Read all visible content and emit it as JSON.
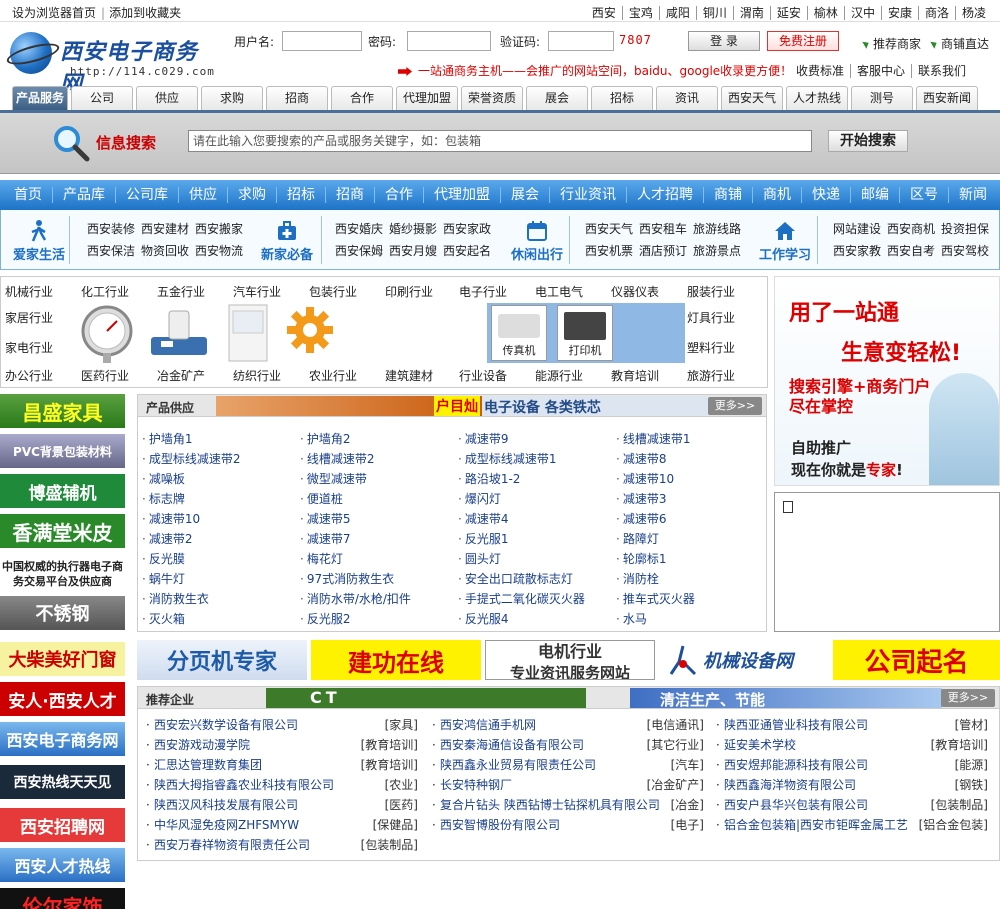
{
  "topbar": {
    "set_home": "设为浏览器首页",
    "bookmark": "添加到收藏夹",
    "cities": [
      "西安",
      "宝鸡",
      "咸阳",
      "铜川",
      "渭南",
      "延安",
      "榆林",
      "汉中",
      "安康",
      "商洛",
      "杨凌"
    ]
  },
  "logo": {
    "name": "西安电子商务网",
    "url": "http://114.c029.com"
  },
  "login": {
    "username_label": "用户名:",
    "password_label": "密码:",
    "captcha_label": "验证码:",
    "captcha_value": "7807",
    "login_button": "登 录",
    "register_button": "免费注册",
    "recommend_merchant": "推荐商家",
    "shop_direct": "商铺直达"
  },
  "promo": {
    "text": "一站通商务主机——会推广的网站空间，baidu、google收录更方便！",
    "links": [
      "收费标准",
      "客服中心",
      "联系我们"
    ]
  },
  "tabs": [
    "产品服务",
    "公司",
    "供应",
    "求购",
    "招商",
    "合作",
    "代理加盟",
    "荣誉资质",
    "展会",
    "招标",
    "资讯",
    "西安天气",
    "人才热线",
    "测号",
    "西安新闻"
  ],
  "search": {
    "label": "信息搜索",
    "placeholder": "请在此输入您要搜索的产品或服务关键字，如：包装箱",
    "button": "开始搜索"
  },
  "mainnav": [
    "首页",
    "产品库",
    "公司库",
    "供应",
    "求购",
    "招标",
    "招商",
    "合作",
    "代理加盟",
    "展会",
    "行业资讯",
    "人才招聘",
    "商铺",
    "商机",
    "快递",
    "邮编",
    "区号",
    "新闻"
  ],
  "life": {
    "cat1": {
      "name": "爱家生活",
      "links": [
        [
          "西安装修",
          "西安建材",
          "西安搬家"
        ],
        [
          "西安保洁",
          "物资回收",
          "西安物流"
        ]
      ]
    },
    "cat2": {
      "name": "新家必备",
      "links": [
        [
          "西安婚庆",
          "婚纱摄影",
          "西安家政"
        ],
        [
          "西安保姆",
          "西安月嫂",
          "西安起名"
        ]
      ]
    },
    "cat3": {
      "name": "休闲出行",
      "links": [
        [
          "西安天气",
          "西安租车",
          "旅游线路"
        ],
        [
          "西安机票",
          "酒店预订",
          "旅游景点"
        ]
      ]
    },
    "cat4": {
      "name": "工作学习",
      "links": [
        [
          "网站建设",
          "西安商机",
          "投资担保"
        ],
        [
          "西安家教",
          "西安自考",
          "西安驾校"
        ]
      ]
    }
  },
  "industries": {
    "row1": [
      "机械行业",
      "化工行业",
      "五金行业",
      "汽车行业",
      "包装行业",
      "印刷行业",
      "电子行业",
      "电工电气",
      "仪器仪表",
      "服装行业"
    ],
    "left2": "家居行业",
    "left3": "家电行业",
    "right2": "灯具行业",
    "right3": "塑料行业",
    "row4": [
      "办公行业",
      "医药行业",
      "冶金矿产",
      "纺织行业",
      "农业行业",
      "建筑建材",
      "行业设备",
      "能源行业",
      "教育培训",
      "旅游行业"
    ],
    "product_labels": [
      "传真机",
      "打印机"
    ]
  },
  "right_ad": {
    "line1": "用了一站通",
    "line2": "生意变轻松!",
    "line3a": "搜索引擎+商务门户",
    "line3b": "尽在掌控",
    "line4a": "自助推广",
    "line4b_pre": "现在你就是",
    "line4b_em": "专家",
    "line4b_post": "!"
  },
  "left_banners": [
    "昌盛家具",
    "PVC背景包装材料",
    "博盛辅机",
    "香满堂米皮",
    "中国权威的执行器电子商务交易平台及供应商",
    "不锈钢",
    "大柴美好门窗",
    "安人·西安人才",
    "西安电子商务网",
    "西安热线天天见",
    "西安招聘网",
    "西安人才热线",
    "伦尔家饰"
  ],
  "supply": {
    "title": "产品供应",
    "banner1": "户目灿",
    "banner2": "电子设备 各类铁芯",
    "more": "更多>>",
    "col1": [
      "护墙角1",
      "成型标线减速带2",
      "减噪板",
      "标志牌",
      "减速带10",
      "减速带2",
      "反光膜",
      "蜗牛灯",
      "消防救生衣",
      "灭火箱"
    ],
    "col2": [
      "护墙角2",
      "线槽减速带2",
      "微型减速带",
      "便道桩",
      "减速带5",
      "减速带7",
      "梅花灯",
      "97式消防救生衣",
      "消防水带/水枪/扣件",
      "反光服2"
    ],
    "col3": [
      "减速带9",
      "成型标线减速带1",
      "路沿坡1-2",
      "爆闪灯",
      "减速带4",
      "反光服1",
      "圆头灯",
      "安全出口疏散标志灯",
      "手提式二氧化碳灭火器",
      "反光服4"
    ],
    "col4": [
      "线槽减速带1",
      "减速带8",
      "减速带10",
      "减速带3",
      "减速带6",
      "路障灯",
      "轮廓标1",
      "消防栓",
      "推车式灭火器",
      "水马"
    ]
  },
  "hbanners": {
    "b1": "分页机专家",
    "b2": "建功在线",
    "b3a": "电机行业",
    "b3b": "专业资讯服务网站",
    "b4": "机械设备网",
    "b5": "公司起名"
  },
  "companies": {
    "title": "推荐企业",
    "banner1": "CT",
    "banner2": "清洁生产、节能",
    "more": "更多>>",
    "col1": [
      [
        "西安宏兴数学设备有限公司",
        "[家具]"
      ],
      [
        "西安游戏动漫学院",
        "[教育培训]"
      ],
      [
        "汇思达管理数育集团",
        "[教育培训]"
      ],
      [
        "陕西大拇指睿鑫农业科技有限公司",
        "[农业]"
      ],
      [
        "陕西汉风科技发展有限公司",
        "[医药]"
      ],
      [
        "中华风湿免疫网ZHFSMYW",
        "[保健品]"
      ],
      [
        "西安万春祥物资有限责任公司",
        "[包装制品]"
      ]
    ],
    "col2": [
      [
        "西安鸿信通手机网",
        "[电信通讯]"
      ],
      [
        "西安秦海通信设备有限公司",
        "[其它行业]"
      ],
      [
        "陕西鑫永业贸易有限责任公司",
        "[汽车]"
      ],
      [
        "长安特种钢厂",
        "[冶金矿产]"
      ],
      [
        "复合片钻头 陕西钻博士钻探机具有限公司",
        "[冶金]"
      ],
      [
        "西安智博股份有限公司",
        "[电子]"
      ]
    ],
    "col3": [
      [
        "陕西亚通管业科技有限公司",
        "[管材]"
      ],
      [
        "延安美术学校",
        "[教育培训]"
      ],
      [
        "西安煜邦能源科技有限公司",
        "[能源]"
      ],
      [
        "陕西鑫海洋物资有限公司",
        "[钢铁]"
      ],
      [
        "西安户县华兴包装有限公司",
        "[包装制品]"
      ],
      [
        "铝合金包装箱|西安市钜晖金属工艺",
        "[铝合金包装]"
      ]
    ]
  },
  "colors": {
    "nav_blue": "#1d73c7",
    "red": "#d00000",
    "link_blue": "#1a3f8a"
  }
}
